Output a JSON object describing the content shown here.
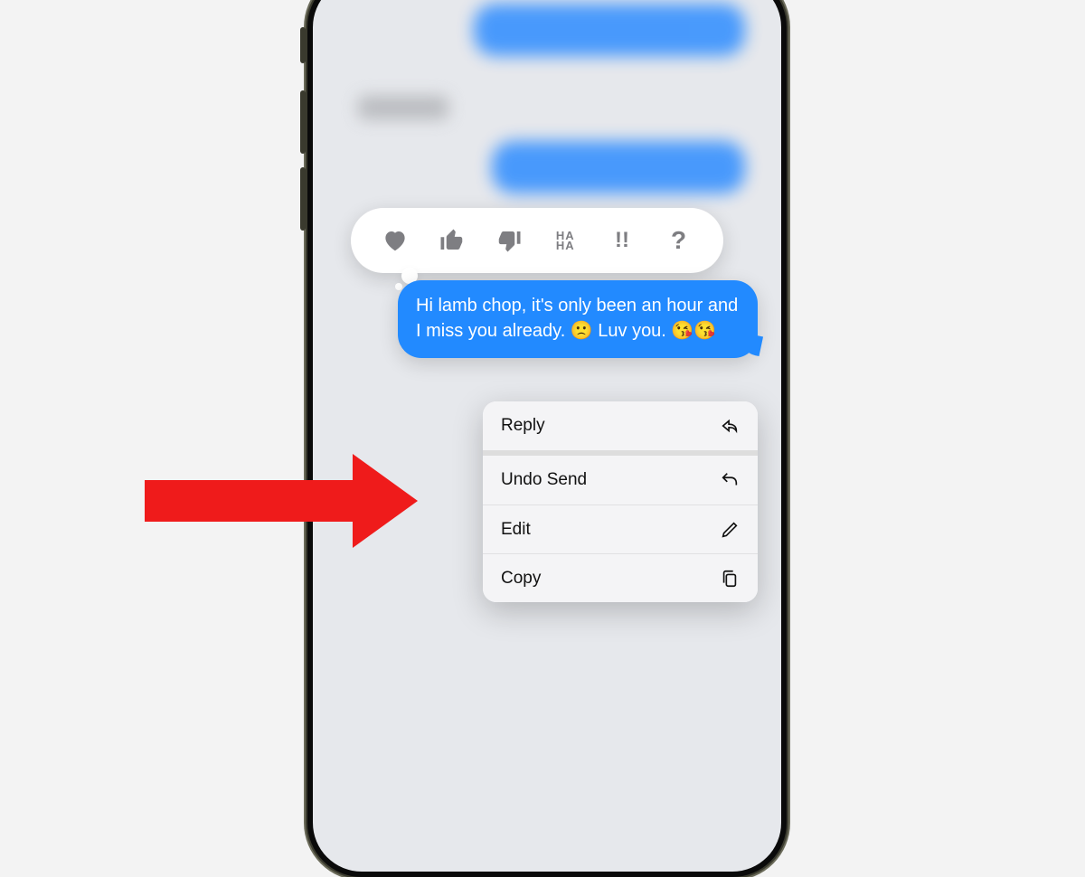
{
  "tapback": {
    "heart": "heart",
    "thumbs_up": "thumbs-up",
    "thumbs_down": "thumbs-down",
    "haha_top": "HA",
    "haha_bot": "HA",
    "exclaim": "!!",
    "question": "?"
  },
  "message": {
    "text": "Hi lamb chop, it's only been an hour and I miss you already. 🙁 Luv you. 😘😘"
  },
  "context_menu": {
    "reply": "Reply",
    "undo_send": "Undo Send",
    "edit": "Edit",
    "copy": "Copy"
  },
  "annotation": {
    "arrow_target": "undo_send"
  }
}
